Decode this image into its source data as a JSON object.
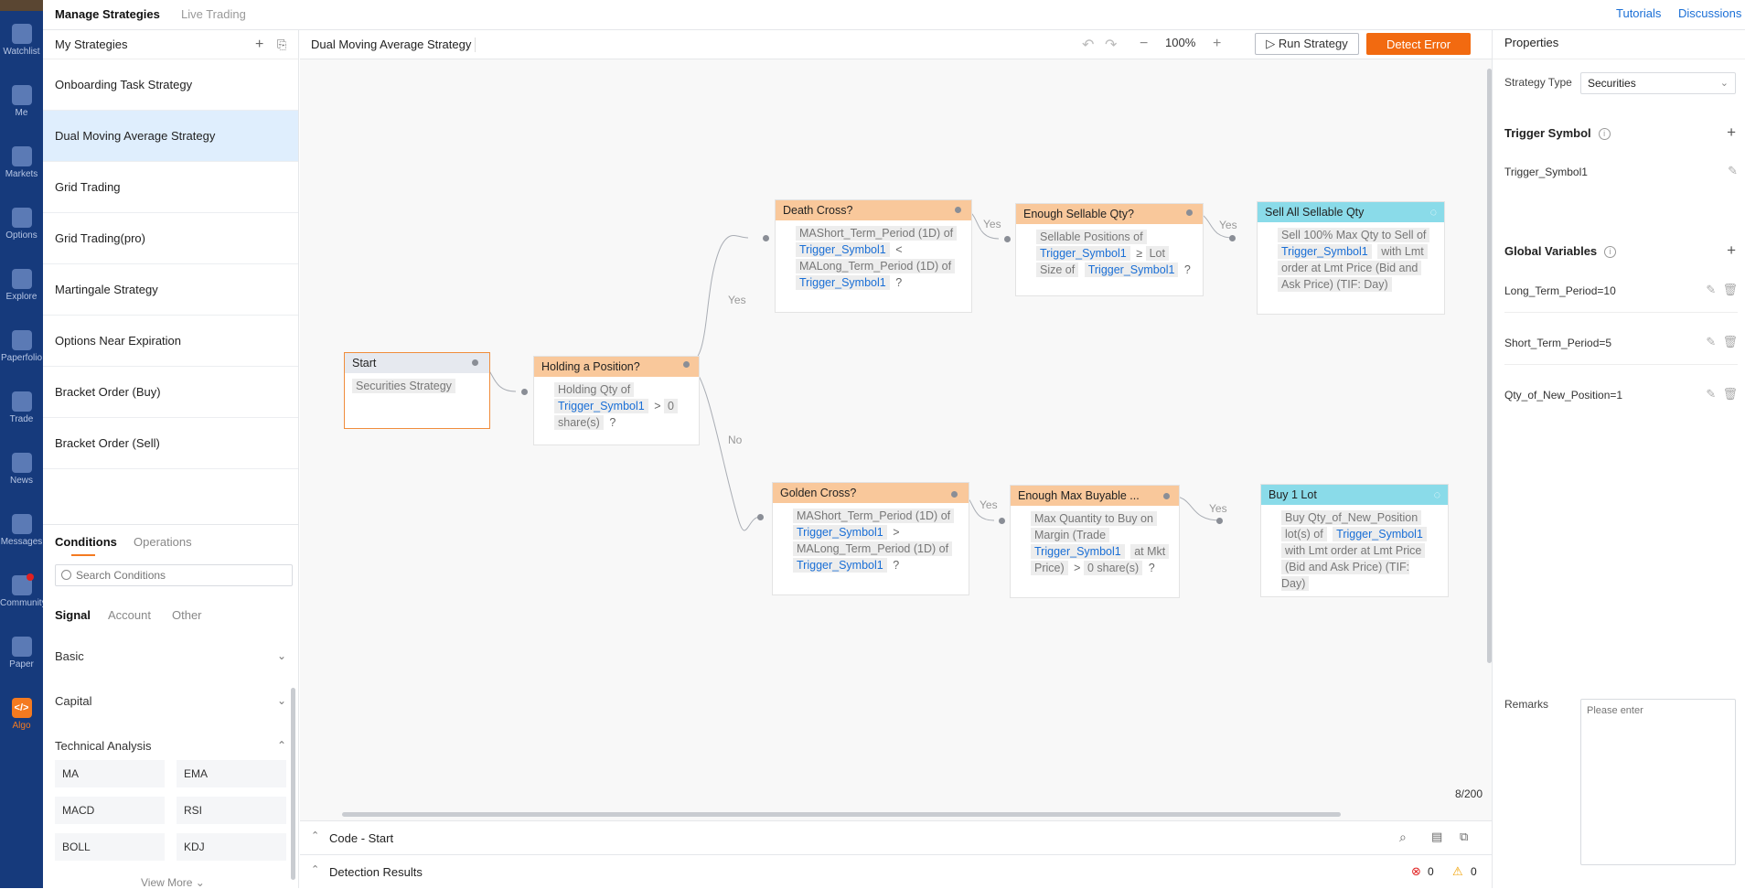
{
  "rail": {
    "items": [
      {
        "label": "Watchlist",
        "icon": "watchlist-icon"
      },
      {
        "label": "Me",
        "icon": "user-icon"
      },
      {
        "label": "Markets",
        "icon": "markets-icon"
      },
      {
        "label": "Options",
        "icon": "options-icon"
      },
      {
        "label": "Explore",
        "icon": "explore-icon"
      },
      {
        "label": "Paperfolio",
        "icon": "paperfolio-icon"
      },
      {
        "label": "Trade",
        "icon": "trade-icon"
      },
      {
        "label": "News",
        "icon": "news-icon"
      },
      {
        "label": "Messages",
        "icon": "messages-icon"
      },
      {
        "label": "Community",
        "icon": "community-icon"
      },
      {
        "label": "Paper",
        "icon": "paper-icon"
      },
      {
        "label": "Algo",
        "icon": "algo-icon"
      }
    ],
    "active": "Algo",
    "algo_glyph": "</>"
  },
  "topbar": {
    "tabs": [
      "Manage Strategies",
      "Live Trading"
    ],
    "links": [
      "Tutorials",
      "Discussions"
    ]
  },
  "strategies": {
    "heading": "My Strategies",
    "add_glyph": "+",
    "items": [
      "Onboarding Task Strategy",
      "Dual Moving Average Strategy",
      "Grid Trading",
      "Grid Trading(pro)",
      "Martingale Strategy",
      "Options Near Expiration",
      "Bracket Order (Buy)",
      "Bracket Order (Sell)"
    ],
    "selected": "Dual Moving Average Strategy"
  },
  "conditions": {
    "tabs": [
      "Conditions",
      "Operations"
    ],
    "search_placeholder": "Search Conditions",
    "subtabs": [
      "Signal",
      "Account",
      "Other"
    ],
    "groups": [
      {
        "label": "Basic",
        "chevron": "⌄"
      },
      {
        "label": "Capital",
        "chevron": "⌄"
      },
      {
        "label": "Technical Analysis",
        "chevron": "⌃"
      }
    ],
    "chips": [
      "MA",
      "EMA",
      "MACD",
      "RSI",
      "BOLL",
      "KDJ"
    ],
    "view_more": "View More ⌄"
  },
  "canvas": {
    "title": "Dual Moving Average Strategy",
    "zoom": "100%",
    "zoom_out": "−",
    "zoom_in": "+",
    "undo": "↶",
    "redo": "↷",
    "run_label": "▷ Run Strategy",
    "detect_label": "Detect Error",
    "counter": "8/200",
    "edge_labels": {
      "yes": "Yes",
      "no": "No"
    },
    "nodes": {
      "start": {
        "title": "Start",
        "body": "Securities Strategy"
      },
      "holding": {
        "title": "Holding a Position?",
        "t1": "Holding Qty of",
        "sym": "Trigger_Symbol1",
        "op": ">",
        "val": "0",
        "unit": "share(s)",
        "q": "?"
      },
      "death": {
        "title": "Death Cross?",
        "t1": "MAShort_Term_Period (1D) of",
        "sym1": "Trigger_Symbol1",
        "op": "<",
        "t2": "MALong_Term_Period (1D) of",
        "sym2": "Trigger_Symbol1",
        "q": "?"
      },
      "sellable": {
        "title": "Enough Sellable Qty?",
        "t1": "Sellable Positions of",
        "sym1": "Trigger_Symbol1",
        "op": "≥",
        "t2": "Lot",
        "t3": "Size of",
        "sym2": "Trigger_Symbol1",
        "q": "?"
      },
      "sellall": {
        "title": "Sell All Sellable Qty",
        "t1": "Sell 100% Max Qty to Sell of",
        "sym": "Trigger_Symbol1",
        "t2": "with Lmt",
        "t3": "order at Lmt Price (Bid and",
        "t4": "Ask Price) (TIF: Day)"
      },
      "golden": {
        "title": "Golden Cross?",
        "t1": "MAShort_Term_Period (1D) of",
        "sym1": "Trigger_Symbol1",
        "op": ">",
        "t2": "MALong_Term_Period (1D) of",
        "sym2": "Trigger_Symbol1",
        "q": "?"
      },
      "buyable": {
        "title": "Enough Max Buyable ...",
        "t1": "Max Quantity to Buy on",
        "t2": "Margin (Trade",
        "sym": "Trigger_Symbol1",
        "t3": "at Mkt",
        "t4": "Price)",
        "op": ">",
        "val": "0 share(s)",
        "q": "?"
      },
      "buy": {
        "title": "Buy 1 Lot",
        "t1": "Buy Qty_of_New_Position",
        "t2": "lot(s) of",
        "sym": "Trigger_Symbol1",
        "t3": "with Lmt order at Lmt Price",
        "t4": "(Bid and Ask Price) (TIF: Day)"
      }
    }
  },
  "bottom": {
    "code": "Code - Start",
    "detection": "Detection Results",
    "errors": "0",
    "warnings": "0"
  },
  "properties": {
    "title": "Properties",
    "strategy_type_label": "Strategy Type",
    "strategy_type_value": "Securities",
    "trigger_heading": "Trigger Symbol",
    "trigger_symbols": [
      "Trigger_Symbol1"
    ],
    "globals_heading": "Global Variables",
    "globals": [
      "Long_Term_Period=10",
      "Short_Term_Period=5",
      "Qty_of_New_Position=1"
    ],
    "remarks_label": "Remarks",
    "remarks_placeholder": "Please enter"
  },
  "colors": {
    "rail": "#163a7c",
    "accent": "#f26a10",
    "link": "#1a6fd6",
    "selected_row": "#dfeefd",
    "condition_header": "#f9c89b",
    "action_header": "#8adbe9"
  }
}
